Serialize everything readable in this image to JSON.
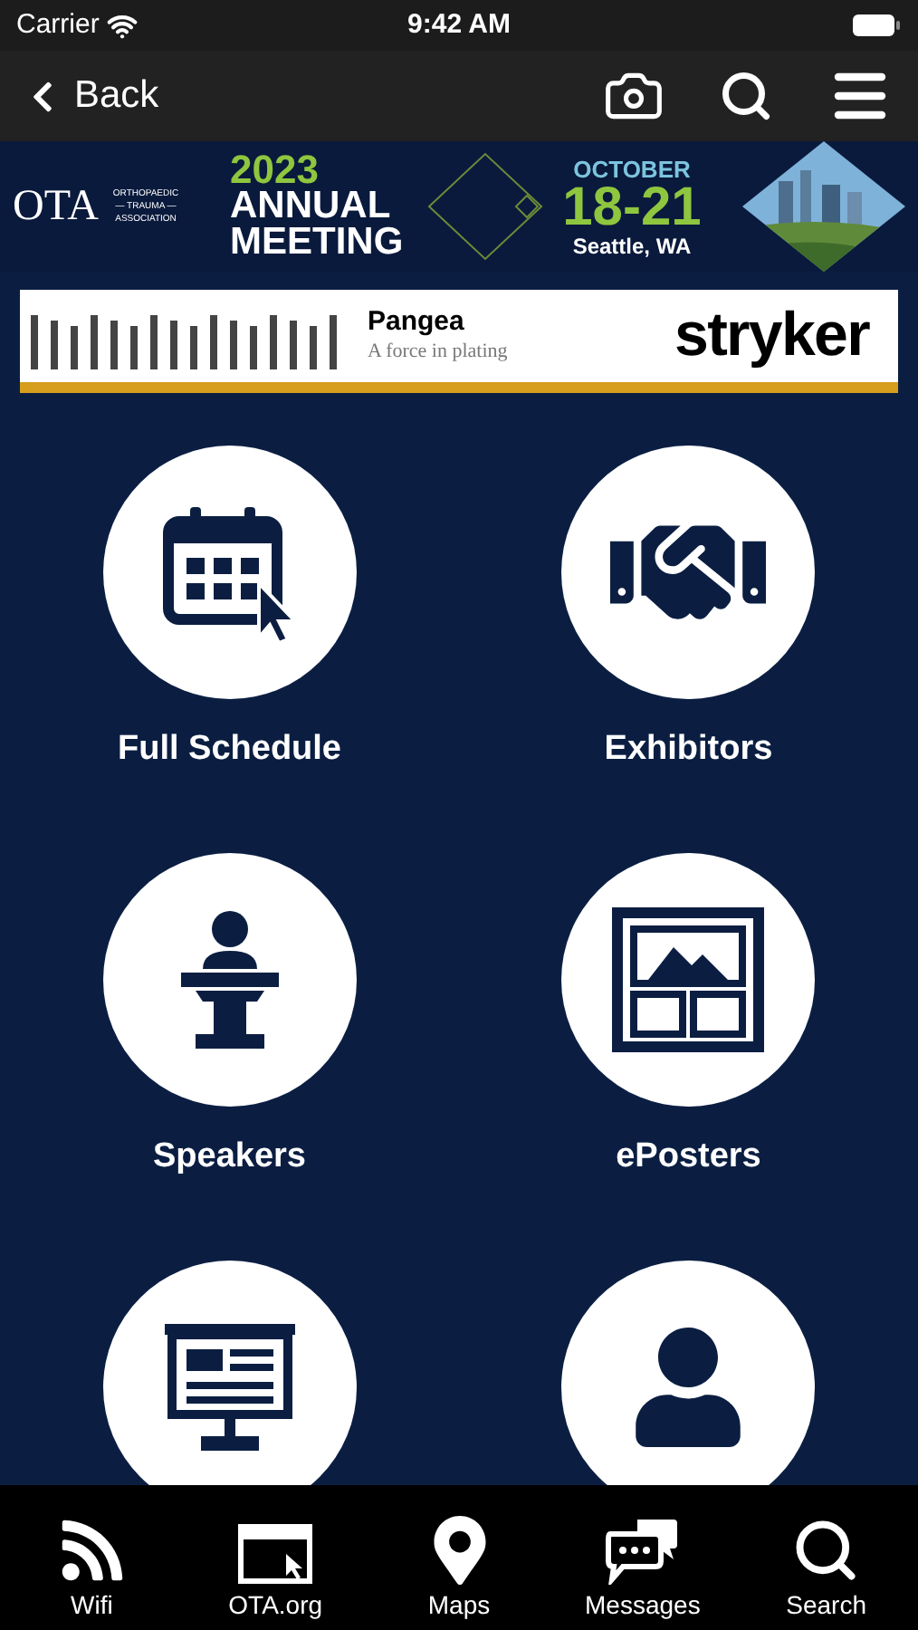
{
  "status_bar": {
    "carrier": "Carrier",
    "time": "9:42 AM"
  },
  "nav_bar": {
    "back": "Back"
  },
  "banner": {
    "org_line_1": "ORTHOPAEDIC",
    "org_line_2": "— TRAUMA —",
    "org_line_3": "ASSOCIATION",
    "logo": "OTA",
    "year": "2023",
    "title_1": "ANNUAL",
    "title_2": "MEETING",
    "month": "OCTOBER",
    "dates": "18-21",
    "place": "Seattle, WA"
  },
  "ad": {
    "product": "Pangea",
    "tagline": "A force in plating",
    "brand": "stryker"
  },
  "tiles": [
    {
      "kind": "schedule",
      "label": "Full Schedule"
    },
    {
      "kind": "exhibitors",
      "label": "Exhibitors"
    },
    {
      "kind": "speakers",
      "label": "Speakers"
    },
    {
      "kind": "eposters",
      "label": "ePosters"
    },
    {
      "kind": "industry"
    },
    {
      "kind": "attendees"
    }
  ],
  "tab_bar": [
    {
      "kind": "wifi",
      "label": "Wifi"
    },
    {
      "kind": "web",
      "label": "OTA.org"
    },
    {
      "kind": "maps",
      "label": "Maps"
    },
    {
      "kind": "messages",
      "label": "Messages"
    },
    {
      "kind": "search",
      "label": "Search"
    }
  ]
}
